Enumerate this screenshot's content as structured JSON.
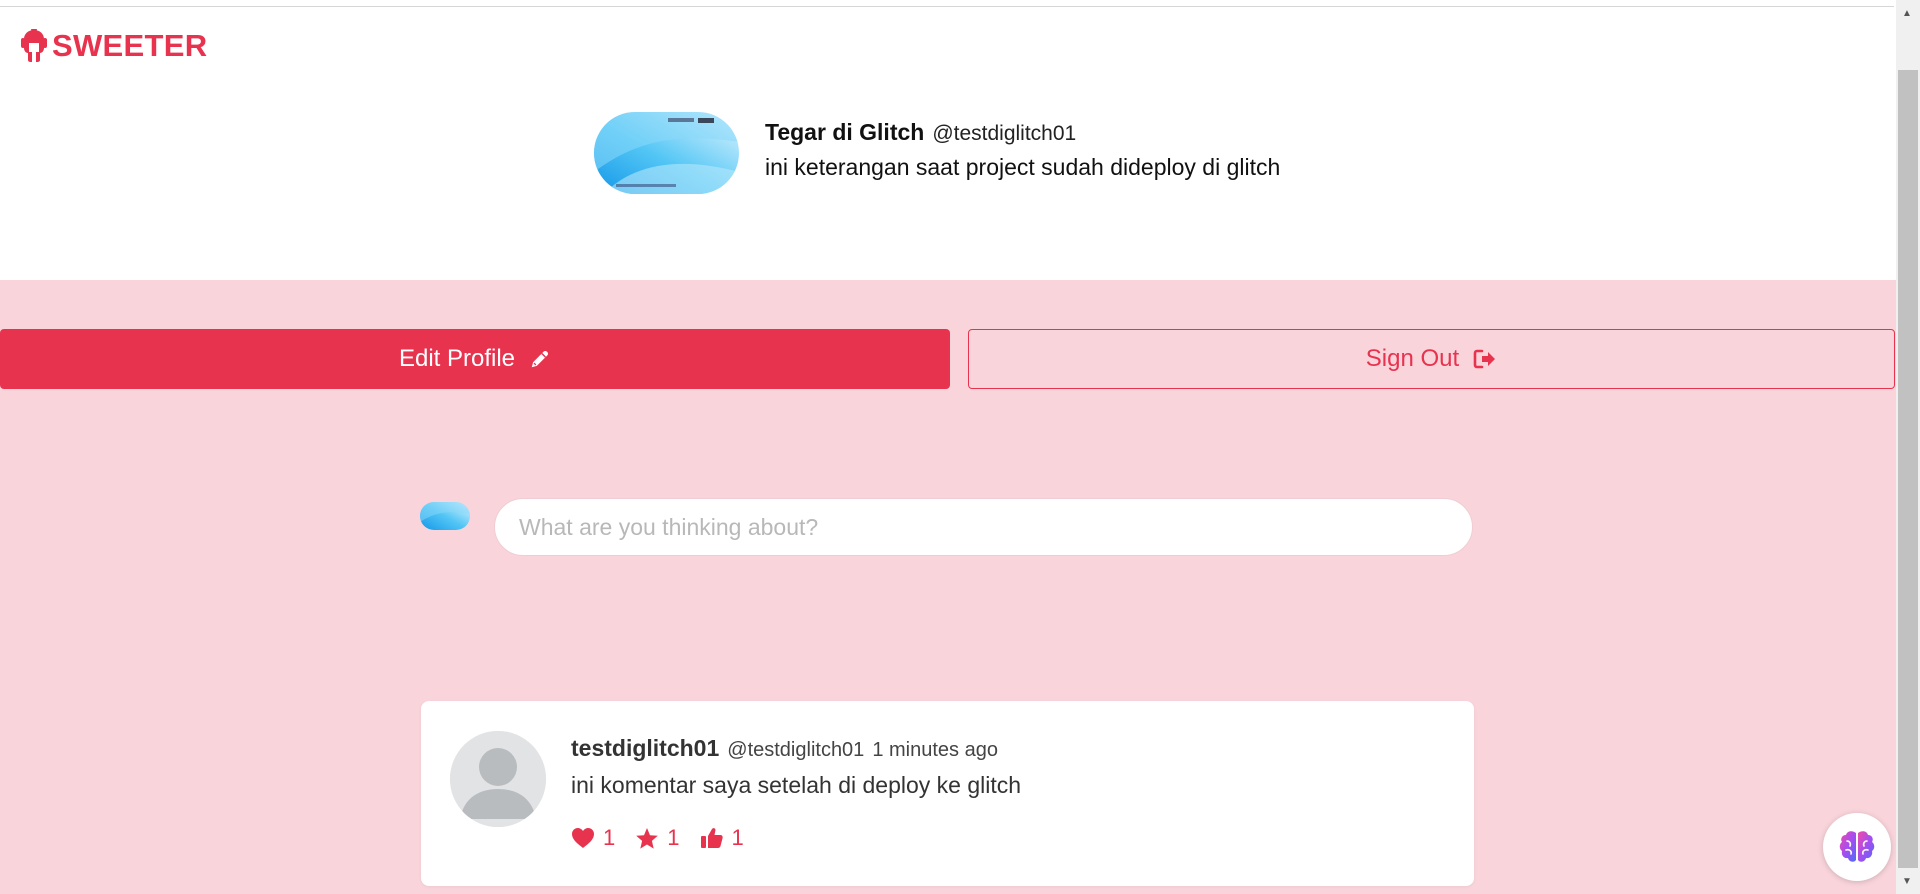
{
  "brand": {
    "name": "SWEETER",
    "icon": "spartan-helmet-icon"
  },
  "profile": {
    "name": "Tegar di Glitch",
    "handle": "@testdiglitch01",
    "bio": "ini keterangan saat project sudah dideploy di glitch"
  },
  "actions": {
    "edit_label": "Edit Profile",
    "edit_icon": "pencil-icon",
    "signout_label": "Sign Out",
    "signout_icon": "sign-out-icon"
  },
  "composer": {
    "placeholder": "What are you thinking about?"
  },
  "post": {
    "username": "testdiglitch01",
    "handle": "@testdiglitch01",
    "time": "1 minutes ago",
    "text": "ini komentar saya setelah di deploy ke glitch",
    "reactions": [
      {
        "icon": "heart-icon",
        "count": "1"
      },
      {
        "icon": "star-icon",
        "count": "1"
      },
      {
        "icon": "thumbs-up-icon",
        "count": "1"
      }
    ]
  },
  "colors": {
    "accent": "#e8334f",
    "pink_bg": "#f9d4db"
  }
}
